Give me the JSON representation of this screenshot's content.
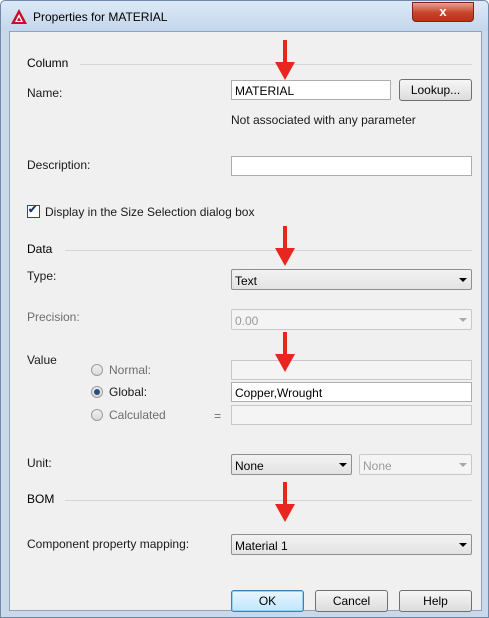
{
  "window": {
    "title": "Properties for MATERIAL",
    "close_label": "x"
  },
  "column": {
    "section_title": "Column",
    "name_label": "Name:",
    "name_value": "MATERIAL",
    "lookup_button": "Lookup...",
    "association_note": "Not associated with any parameter",
    "description_label": "Description:",
    "description_value": "",
    "display_checkbox_label": "Display in the Size Selection dialog box",
    "display_checked": true
  },
  "data": {
    "section_title": "Data",
    "type_label": "Type:",
    "type_value": "Text",
    "precision_label": "Precision:",
    "precision_value": "0.00",
    "value_label": "Value",
    "normal_label": "Normal:",
    "normal_value": "",
    "global_label": "Global:",
    "global_value": "Copper,Wrought",
    "calculated_label": "Calculated",
    "equals_sign": "=",
    "calculated_value": "",
    "selected_value_mode": "Global",
    "unit_label": "Unit:",
    "unit_value": "None",
    "unit_secondary_value": "None"
  },
  "bom": {
    "section_title": "BOM",
    "mapping_label": "Component property mapping:",
    "mapping_value": "Material 1"
  },
  "buttons": {
    "ok": "OK",
    "cancel": "Cancel",
    "help": "Help"
  },
  "colors": {
    "annotation_arrow": "#e8251f",
    "title_bar": "#c9d9ea",
    "close_button": "#c7432a",
    "dialog_background": "#f0f0f0"
  },
  "icons": [
    "autocad-logo-icon",
    "close-icon",
    "checkbox-check-icon",
    "chevron-down-icon",
    "red-arrow-annotation"
  ]
}
